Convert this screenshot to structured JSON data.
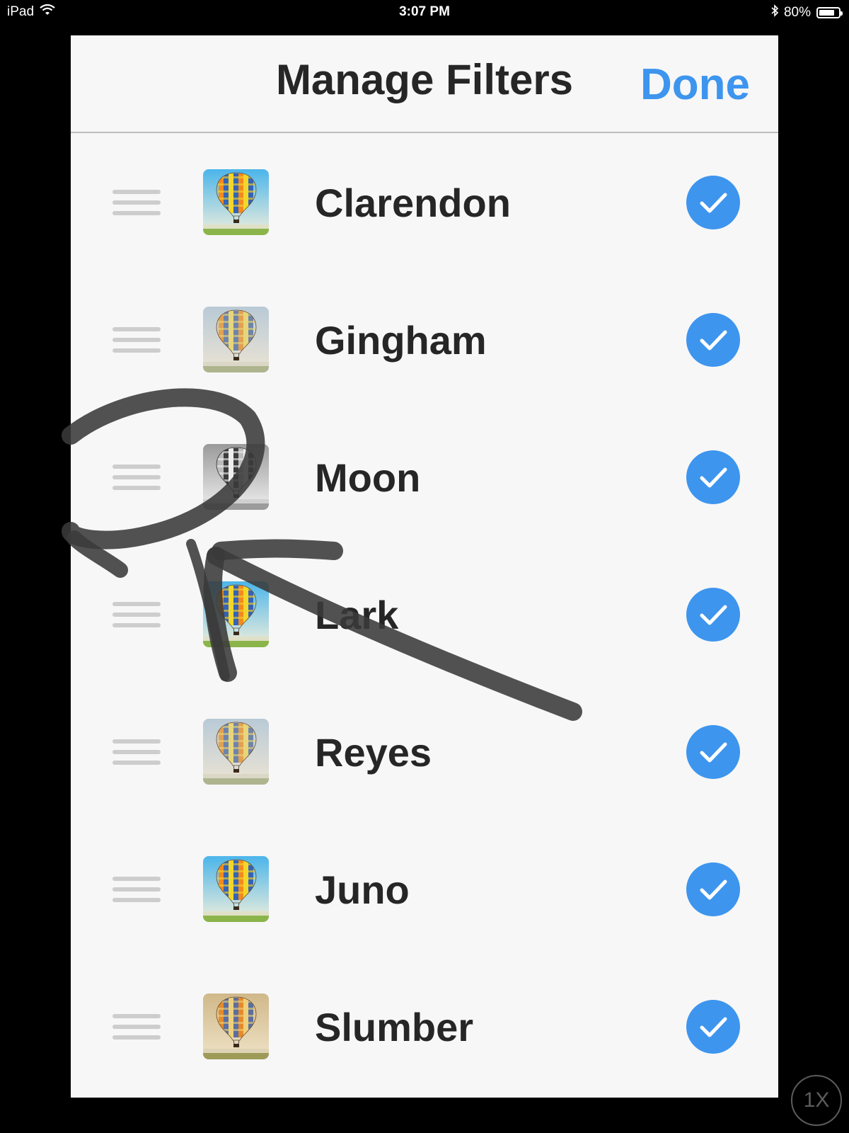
{
  "status_bar": {
    "device": "iPad",
    "time": "3:07 PM",
    "battery_percent": "80%",
    "battery_level": 0.8,
    "wifi_icon": "wifi-icon",
    "bluetooth_icon": "bluetooth-icon"
  },
  "header": {
    "title": "Manage Filters",
    "done_label": "Done"
  },
  "filters": [
    {
      "name": "Clarendon",
      "tone": "vivid",
      "checked": true
    },
    {
      "name": "Gingham",
      "tone": "faded",
      "checked": true
    },
    {
      "name": "Moon",
      "tone": "mono",
      "checked": true
    },
    {
      "name": "Lark",
      "tone": "vivid",
      "checked": true
    },
    {
      "name": "Reyes",
      "tone": "faded",
      "checked": true
    },
    {
      "name": "Juno",
      "tone": "vivid",
      "checked": true
    },
    {
      "name": "Slumber",
      "tone": "warm",
      "checked": true
    }
  ],
  "zoom_label": "1X",
  "colors": {
    "accent": "#3d95ee",
    "text": "#262626",
    "panel": "#f7f7f7",
    "handle": "#cdcdcd",
    "ink": "#3a3a3a"
  }
}
